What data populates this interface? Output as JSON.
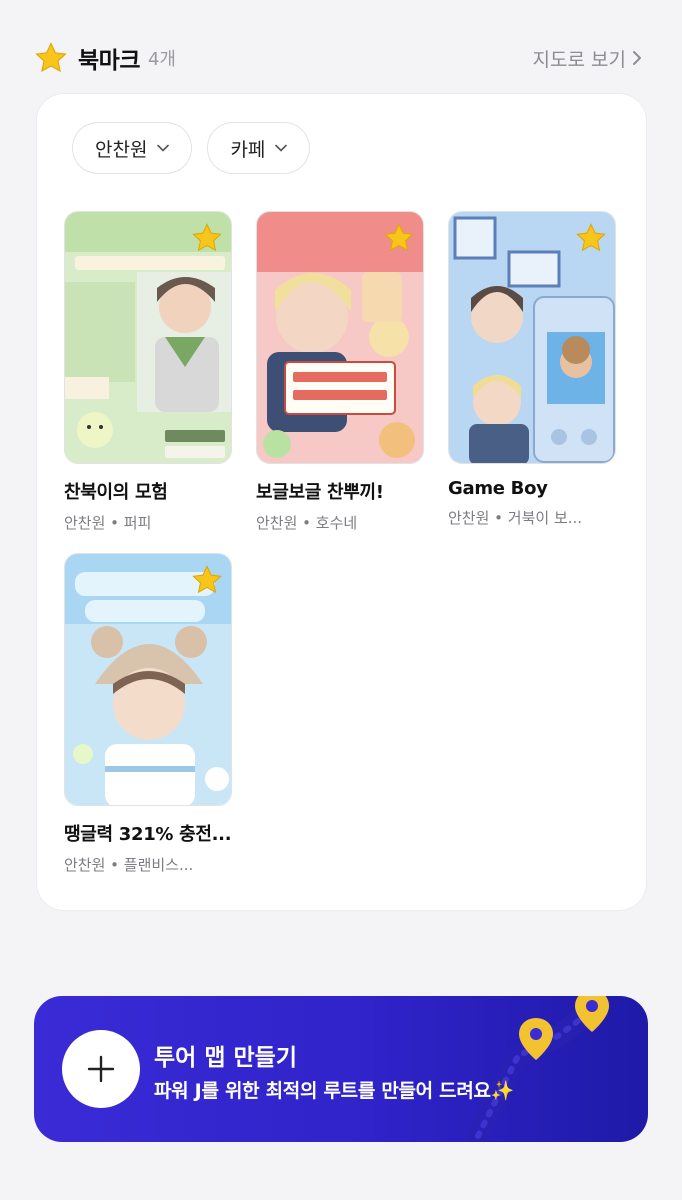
{
  "header": {
    "title": "북마크",
    "count": "4개",
    "map_link": "지도로 보기"
  },
  "filters": [
    {
      "label": "안찬원"
    },
    {
      "label": "카페"
    }
  ],
  "bookmarks": [
    {
      "title": "찬북이의 모험",
      "subtitle": "안찬원 • 퍼피",
      "image": "poster-green-adventure"
    },
    {
      "title": "보글보글 찬뿌끼!",
      "subtitle": "안찬원 • 호수네",
      "image": "poster-pink-tteokbokki"
    },
    {
      "title": "Game Boy",
      "subtitle": "안찬원 • 거북이 보...",
      "image": "poster-blue-gameboy"
    },
    {
      "title": "땡글력 321% 충전...",
      "subtitle": "안찬원 • 플랜비스...",
      "image": "poster-sky-charge"
    }
  ],
  "banner": {
    "title": "투어 맵 만들기",
    "subtitle": "파워 J를 위한 최적의 루트를 만들어 드려요✨"
  },
  "colors": {
    "accent": "#3a2bd6",
    "star": "#f5c518",
    "pin": "#f2c230"
  }
}
